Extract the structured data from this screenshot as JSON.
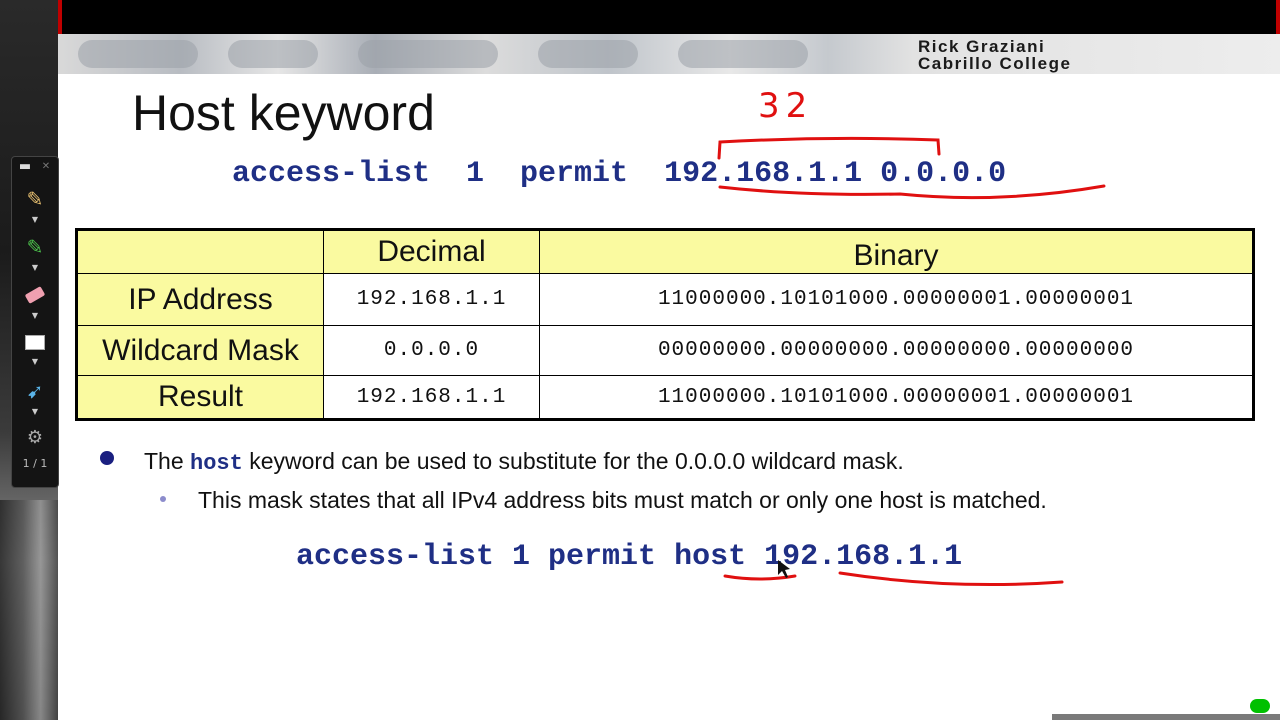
{
  "banner": {
    "author": "Rick Graziani",
    "college": "Cabrillo College"
  },
  "toolbar": {
    "page_indicator": "1 / 1",
    "tools": [
      "minimize-icon",
      "close-icon",
      "pencil-icon",
      "highlighter-icon",
      "eraser-icon",
      "rectangle-icon",
      "pointer-icon",
      "gear-icon"
    ]
  },
  "slide": {
    "title": "Host keyword",
    "command1": {
      "part1": "access-list  1  permit  ",
      "address": "192.168.1.1",
      "mask": "0.0.0.0"
    },
    "table": {
      "headers": [
        "",
        "Decimal",
        "Binary"
      ],
      "rows": [
        {
          "label": "IP Address",
          "decimal": "192.168.1.1",
          "binary": "11000000.10101000.00000001.00000001"
        },
        {
          "label": "Wildcard Mask",
          "decimal": "0.0.0.0",
          "binary": "00000000.00000000.00000000.00000000"
        },
        {
          "label": "Result",
          "decimal": "192.168.1.1",
          "binary": "11000000.10101000.00000001.00000001"
        }
      ]
    },
    "bullet1": {
      "before": "The ",
      "keyword": "host",
      "after": " keyword can be used to substitute for the 0.0.0.0 wildcard mask."
    },
    "bullet2": "This mask states that all IPv4 address bits must match or only one host is matched.",
    "command2": {
      "part1": "access-list 1 permit ",
      "keyword": "host",
      "address": "192.168.1.1"
    },
    "annotation": "32"
  },
  "colors": {
    "code_blue": "#1f2f85",
    "table_yellow": "#fafaa0",
    "ink_red": "#e01010",
    "status_green": "#00c000"
  }
}
